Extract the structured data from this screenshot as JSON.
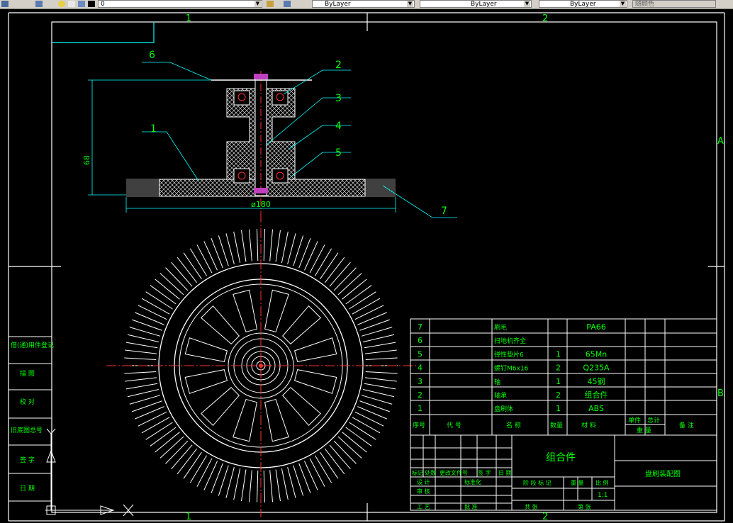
{
  "toolbar": {
    "layer_value": "0",
    "color_value": "ByLayer",
    "linetype_value": "ByLayer",
    "lineweight_value": "ByLayer",
    "plotstyle_value": "随颜色"
  },
  "frame": {
    "zone_top_1": "1",
    "zone_top_2": "2",
    "zone_bottom_1": "1",
    "zone_bottom_2": "2",
    "zone_right_a": "A",
    "zone_right_b": "B"
  },
  "section_view": {
    "balloons": [
      "6",
      "2",
      "3",
      "4",
      "5",
      "1",
      "7"
    ],
    "dim_height": "68",
    "dim_diameter": "ø180"
  },
  "left_strip": {
    "labels": [
      "借(通)用件登记",
      "描 图",
      "校 对",
      "旧底图总号",
      "签 字",
      "日 期"
    ]
  },
  "bom": {
    "rows": [
      {
        "no": "7",
        "name": "刷毛",
        "qty": "",
        "material": "PA66"
      },
      {
        "no": "6",
        "name": "扫地机齐全",
        "qty": "",
        "material": ""
      },
      {
        "no": "5",
        "name": "弹性垫片6",
        "qty": "1",
        "material": "65Mn"
      },
      {
        "no": "4",
        "name": "螺钉M6x16",
        "qty": "2",
        "material": "Q235A"
      },
      {
        "no": "3",
        "name": "轴",
        "qty": "1",
        "material": "45钢"
      },
      {
        "no": "2",
        "name": "轴承",
        "qty": "2",
        "material": "组合件"
      },
      {
        "no": "1",
        "name": "盘刷体",
        "qty": "1",
        "material": "ABS"
      }
    ],
    "header": {
      "no": "序号",
      "code": "代 号",
      "name": "名 称",
      "qty": "数量",
      "material": "材 料",
      "single": "单件",
      "total": "总计",
      "weight": "重 量",
      "remark": "备 注"
    }
  },
  "title_block": {
    "drawing_name": "组合件",
    "part_title": "盘刷装配图",
    "revision_labels": [
      "标记",
      "处数",
      "更改文件号",
      "签 字",
      "日 期"
    ],
    "row_labels": [
      "设 计",
      "审 核",
      "工 艺",
      "标准化",
      "批 准"
    ],
    "stage_label": "阶 段 标 记",
    "weight_label": "重 量",
    "scale_label": "比 例",
    "scale_value": "1:1",
    "sheet_total": "共 张",
    "sheet_no": "第 张"
  }
}
